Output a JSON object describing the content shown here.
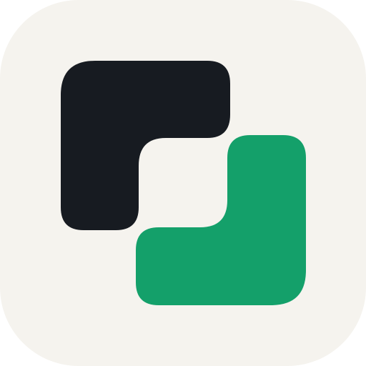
{
  "icon": {
    "name": "app-logo",
    "colors": {
      "background": "#F5F3EE",
      "dark_shape": "#171B21",
      "green_shape": "#14A06A"
    }
  }
}
